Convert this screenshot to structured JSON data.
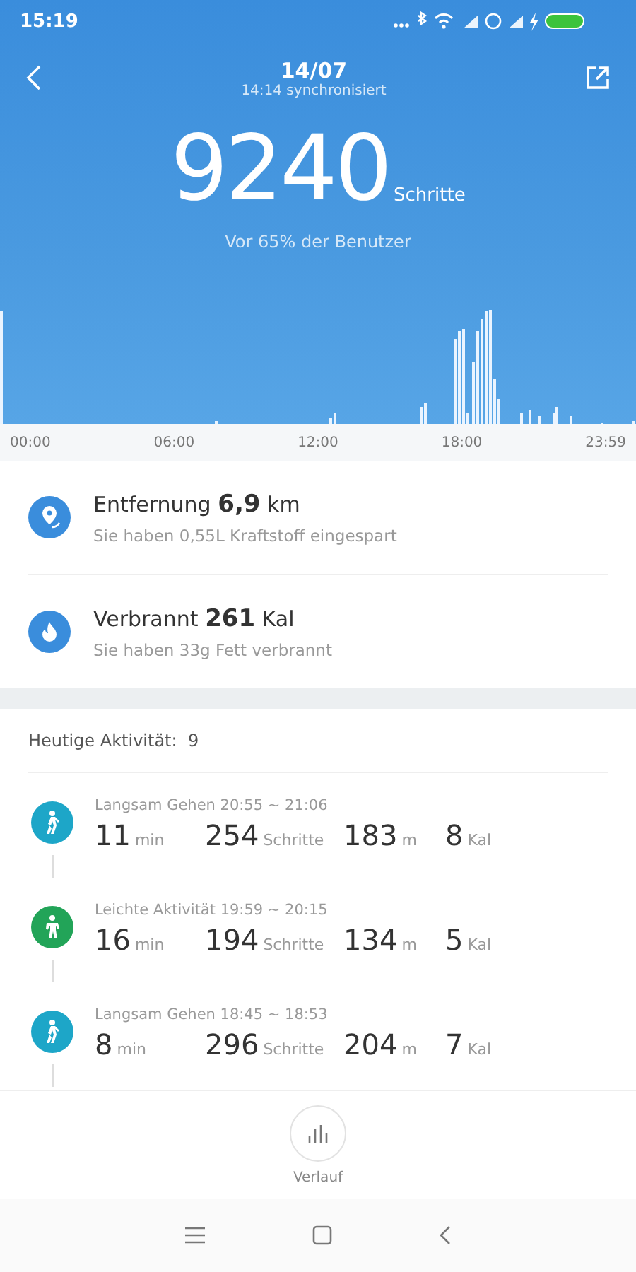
{
  "status_bar": {
    "time": "15:19"
  },
  "header": {
    "date": "14/07",
    "sync": "14:14 synchronisiert",
    "steps": "9240",
    "steps_unit": "Schritte",
    "rank": "Vor 65% der Benutzer"
  },
  "chart": {
    "xlabels": [
      "00:00",
      "06:00",
      "12:00",
      "18:00",
      "23:59"
    ]
  },
  "stats": [
    {
      "kind": "distance",
      "label": "Entfernung",
      "value": "6,9",
      "unit": "km",
      "note": "Sie haben 0,55L Kraftstoff eingespart"
    },
    {
      "kind": "calories",
      "label": "Verbrannt",
      "value": "261",
      "unit": "Kal",
      "note": "Sie haben 33g Fett verbrannt"
    }
  ],
  "activity": {
    "title": "Heutige Aktivität:",
    "count": "9",
    "items": [
      {
        "kind": "walk",
        "color": "#1da6c8",
        "title": "Langsam Gehen 20:55 ~ 21:06",
        "values": [
          {
            "value": "11",
            "unit": "min"
          },
          {
            "value": "254",
            "unit": "Schritte"
          },
          {
            "value": "183",
            "unit": "m"
          },
          {
            "value": "8",
            "unit": "Kal"
          }
        ]
      },
      {
        "kind": "light",
        "color": "#22a458",
        "title": "Leichte Aktivität 19:59 ~ 20:15",
        "values": [
          {
            "value": "16",
            "unit": "min"
          },
          {
            "value": "194",
            "unit": "Schritte"
          },
          {
            "value": "134",
            "unit": "m"
          },
          {
            "value": "5",
            "unit": "Kal"
          }
        ]
      },
      {
        "kind": "walk",
        "color": "#1da6c8",
        "title": "Langsam Gehen 18:45 ~ 18:53",
        "values": [
          {
            "value": "8",
            "unit": "min"
          },
          {
            "value": "296",
            "unit": "Schritte"
          },
          {
            "value": "204",
            "unit": "m"
          },
          {
            "value": "7",
            "unit": "Kal"
          }
        ]
      }
    ]
  },
  "history_button": {
    "label": "Verlauf"
  }
}
